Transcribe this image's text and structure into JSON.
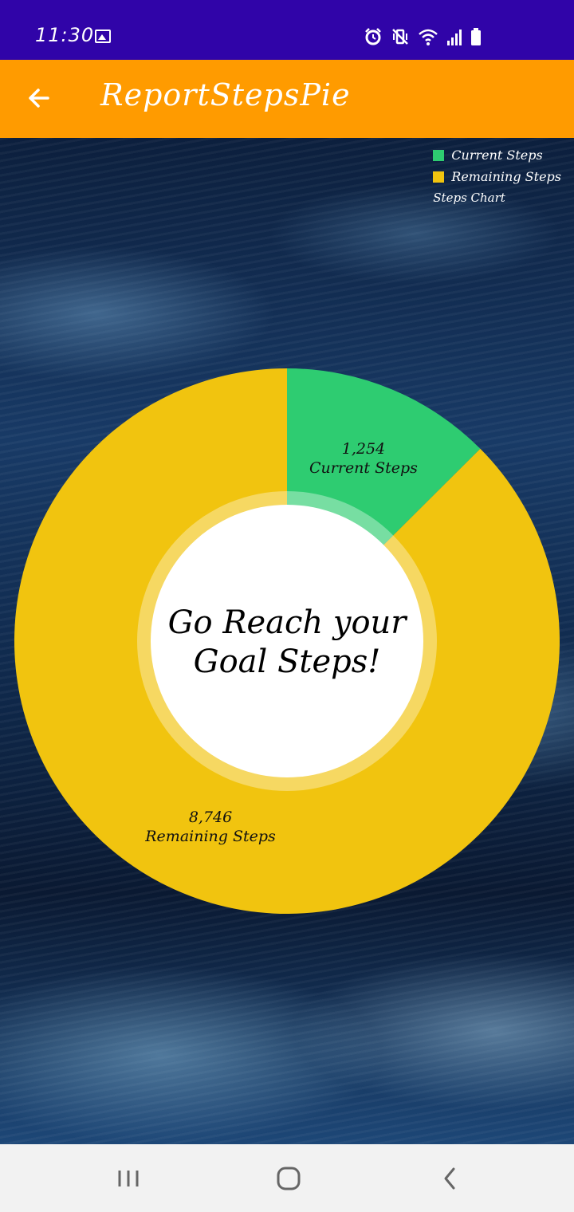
{
  "status_bar": {
    "time": "11:30"
  },
  "app_bar": {
    "title": "ReportStepsPie"
  },
  "colors": {
    "status_bar": "#3004a8",
    "app_bar": "#ff9b00",
    "current_steps": "#2ecc71",
    "remaining_steps": "#f1c40f"
  },
  "legend": {
    "items": [
      {
        "label": "Current Steps",
        "color": "#2ecc71"
      },
      {
        "label": "Remaining Steps",
        "color": "#f1c40f"
      }
    ],
    "title": "Steps Chart"
  },
  "center_text": {
    "line1": "Go Reach your",
    "line2": "Goal Steps!"
  },
  "chart_data": {
    "type": "pie",
    "style": "donut",
    "title": "Steps Chart",
    "labels": [
      "Current Steps",
      "Remaining Steps"
    ],
    "values": [
      1254,
      8746
    ],
    "value_labels": [
      "1,254",
      "8,746"
    ],
    "colors": [
      "#2ecc71",
      "#f1c40f"
    ],
    "legend_position": "top-right"
  },
  "nav_bar": {
    "icons": [
      "recent-apps-icon",
      "home-icon",
      "back-icon"
    ]
  }
}
